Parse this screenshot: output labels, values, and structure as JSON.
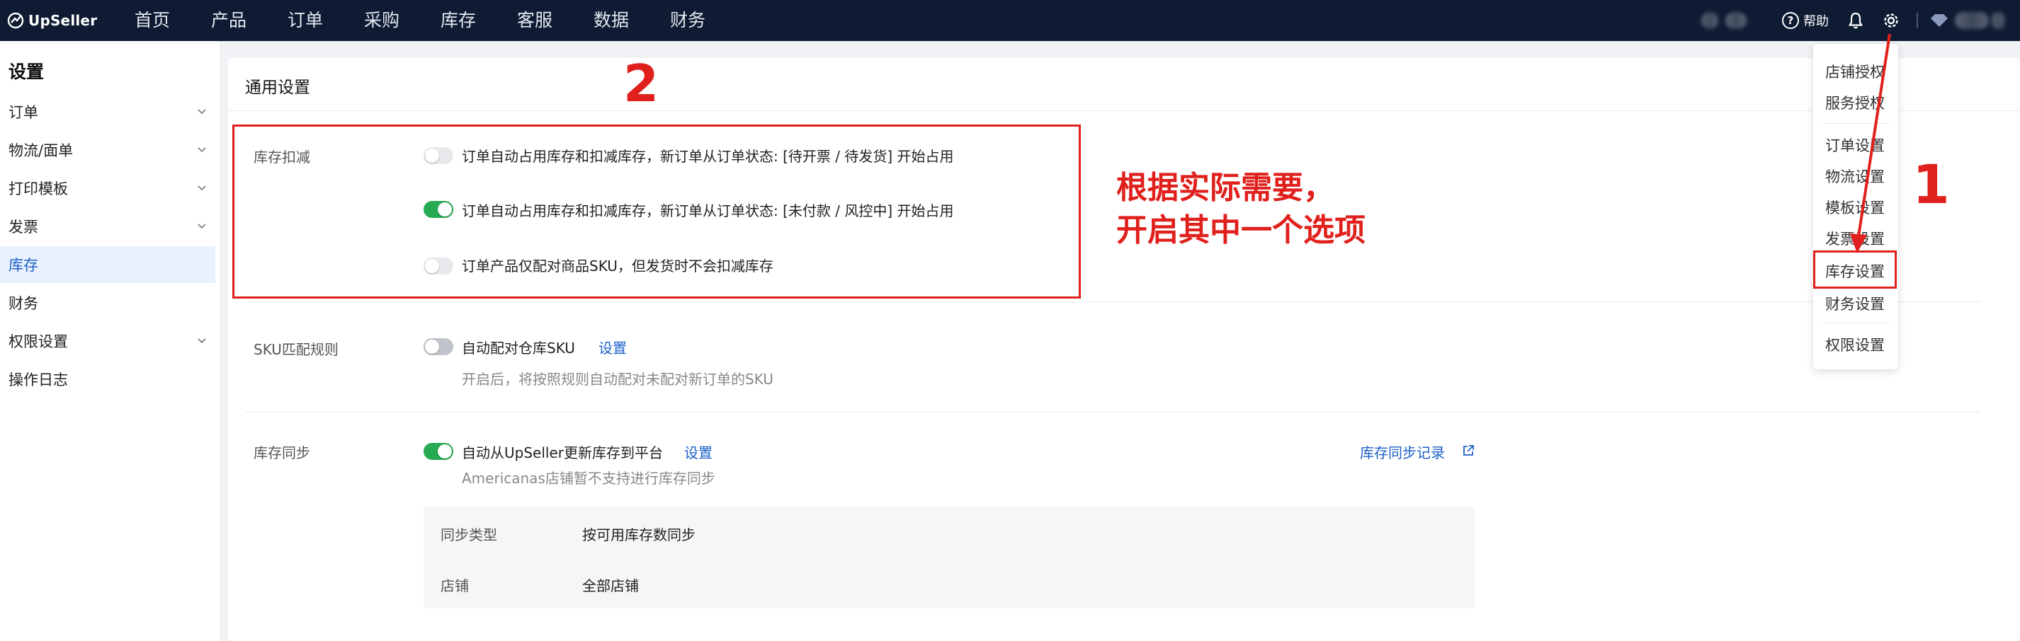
{
  "topbar": {
    "logo_text": "UpSeller",
    "nav": [
      "首页",
      "产品",
      "订单",
      "采购",
      "库存",
      "客服",
      "数据",
      "财务"
    ],
    "help_label": "帮助",
    "icons": {
      "help": "help-circle-icon",
      "bell": "bell-icon",
      "settings": "gear-icon",
      "vip": "diamond-icon"
    }
  },
  "sidebar": {
    "title": "设置",
    "items": [
      {
        "label": "订单",
        "has_chevron": true
      },
      {
        "label": "物流/面单",
        "has_chevron": true
      },
      {
        "label": "打印模板",
        "has_chevron": true
      },
      {
        "label": "发票",
        "has_chevron": true
      },
      {
        "label": "库存",
        "has_chevron": false,
        "active": true
      },
      {
        "label": "财务",
        "has_chevron": false
      },
      {
        "label": "权限设置",
        "has_chevron": true
      },
      {
        "label": "操作日志",
        "has_chevron": false
      }
    ]
  },
  "main": {
    "title": "通用设置",
    "deduction": {
      "label": "库存扣减",
      "options": [
        {
          "text": "订单自动占用库存和扣减库存，新订单从订单状态: [待开票 / 待发货] 开始占用",
          "on": false
        },
        {
          "text": "订单自动占用库存和扣减库存，新订单从订单状态: [未付款 / 风控中] 开始占用",
          "on": true
        },
        {
          "text": "订单产品仅配对商品SKU，但发货时不会扣减库存",
          "on": false
        }
      ]
    },
    "sku_rule": {
      "label": "SKU匹配规则",
      "option": "自动配对仓库SKU",
      "link": "设置",
      "on": false,
      "desc": "开启后，将按照规则自动配对未配对新订单的SKU"
    },
    "stock_sync": {
      "label": "库存同步",
      "option": "自动从UpSeller更新库存到平台",
      "link": "设置",
      "on": true,
      "desc": "Americanas店铺暂不支持进行库存同步",
      "record_link": "库存同步记录",
      "rows": [
        {
          "key": "同步类型",
          "value": "按可用库存数同步"
        },
        {
          "key": "店铺",
          "value": "全部店铺"
        }
      ]
    }
  },
  "dropdown": {
    "items": [
      "店铺授权",
      "服务授权",
      "订单设置",
      "物流设置",
      "模板设置",
      "发票设置",
      "库存设置",
      "财务设置",
      "权限设置"
    ]
  },
  "annotations": {
    "step1": "1",
    "step2": "2",
    "hint_line1": "根据实际需要，",
    "hint_line2": "开启其中一个选项",
    "color": "#e0201c"
  },
  "colors": {
    "topbar": "#0e1b33",
    "accent": "#1c5fc7",
    "toggle_on": "#26ab52",
    "active_bg": "#e8f1fd"
  }
}
